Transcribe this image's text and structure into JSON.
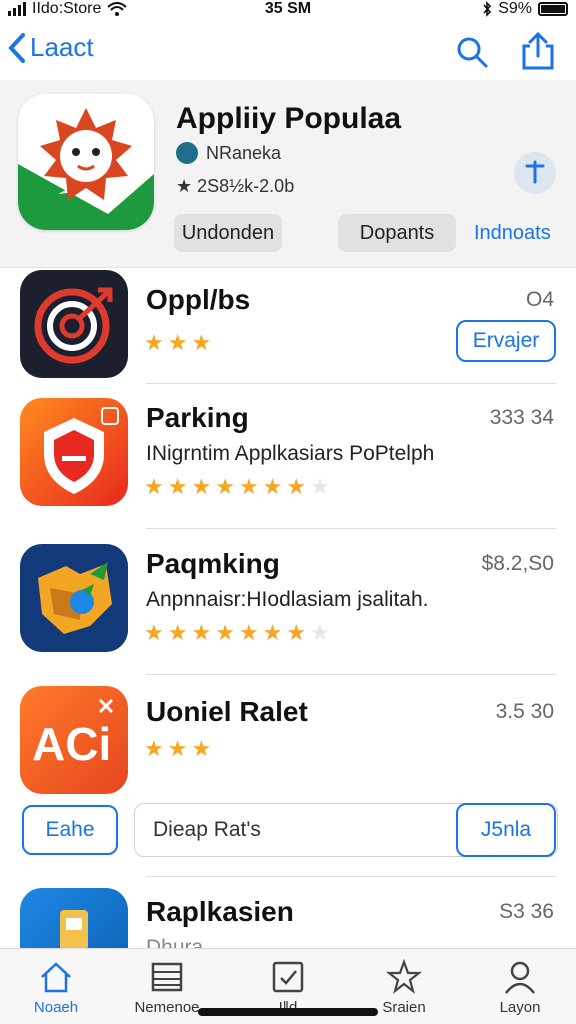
{
  "status_bar": {
    "carrier": "IIdo:Store",
    "time": "35 SM",
    "battery": "S9%",
    "icons": [
      "signal-icon",
      "wifi-icon",
      "bluetooth-icon",
      "battery-icon"
    ]
  },
  "nav": {
    "back_label": "Laact",
    "icons": [
      "chevron-left-icon",
      "search-icon",
      "share-icon"
    ]
  },
  "header": {
    "title": "Appliiy Populaa",
    "developer": "NRaneka",
    "rating_text": "★ 2S8½k-2.0b",
    "button_left": "Undonden",
    "button_middle": "Dopants",
    "link_right": "Indnoats"
  },
  "apps": [
    {
      "name": "Oppl/bs",
      "description": "",
      "price": "O4",
      "stars": 3,
      "action": "Ervajer"
    },
    {
      "name": "Parking",
      "description": "INigrntim Applkasiars PoPtelph",
      "price": "333 34",
      "stars": 7,
      "max_stars": 8
    },
    {
      "name": "Paqmking",
      "description": "Anpnnaisr:HIodlasiam jsalitah.",
      "price": "$8.2,S0",
      "stars": 7,
      "max_stars": 8
    },
    {
      "name": "Uoniel Ralet",
      "description": "",
      "price": "3.5 30",
      "stars": 3
    },
    {
      "name": "Raplkasien",
      "description": "Dhura",
      "price": "S3 36",
      "stars": 0
    }
  ],
  "filter": {
    "left_button": "Eahe",
    "input_value": "Dieap Rat's",
    "right_button": "J5nla"
  },
  "tabs": [
    {
      "label": "Noaeh",
      "icon": "home-icon",
      "active": true
    },
    {
      "label": "Nemenoe",
      "icon": "list-icon",
      "active": false
    },
    {
      "label": "I‖d",
      "icon": "checkbox-icon",
      "active": false
    },
    {
      "label": "Sraien",
      "icon": "star-icon",
      "active": false
    },
    {
      "label": "Layon",
      "icon": "person-icon",
      "active": false
    }
  ],
  "colors": {
    "accent": "#1a73e8",
    "star": "#f5a623",
    "header_bg": "#f3f3f3"
  }
}
